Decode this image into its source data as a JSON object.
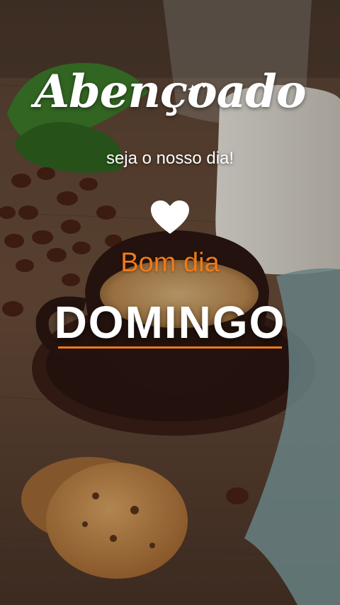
{
  "greeting": {
    "title": "Abençoado",
    "subtitle": "seja o nosso dia!",
    "bom_dia": "Bom dia",
    "day": "DOMINGO"
  },
  "colors": {
    "accent": "#ef7a1a",
    "text": "#ffffff"
  },
  "icons": {
    "heart": "heart-icon",
    "sparkles": "sparkle-icon"
  }
}
